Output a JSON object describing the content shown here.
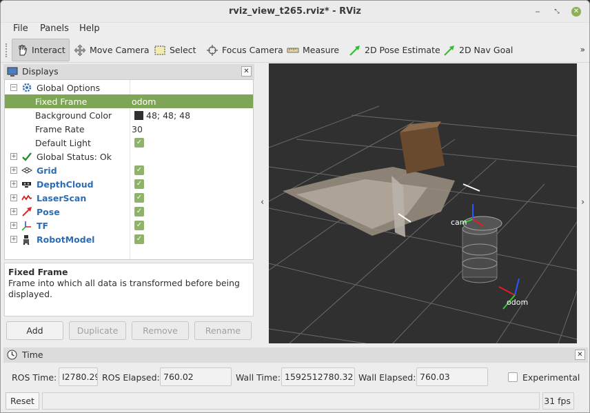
{
  "window": {
    "title": "rviz_view_t265.rviz* - RViz"
  },
  "menu": [
    "File",
    "Panels",
    "Help"
  ],
  "toolbar": {
    "tools": [
      {
        "label": "Interact",
        "icon": "hand-pointer-icon",
        "active": true
      },
      {
        "label": "Move Camera",
        "icon": "move-camera-icon"
      },
      {
        "label": "Select",
        "icon": "select-rect-icon"
      },
      {
        "label": "Focus Camera",
        "icon": "focus-crosshair-icon"
      },
      {
        "label": "Measure",
        "icon": "ruler-icon"
      },
      {
        "label": "2D Pose Estimate",
        "icon": "green-arrow-icon"
      },
      {
        "label": "2D Nav Goal",
        "icon": "green-arrow-icon"
      }
    ],
    "overflow": "»"
  },
  "displays": {
    "title": "Displays",
    "rows": [
      {
        "name": "Global Options",
        "type": "group",
        "expander": "−",
        "icon": "gear-icon"
      },
      {
        "name": "Fixed Frame",
        "value": "odom",
        "selected": true
      },
      {
        "name": "Background Color",
        "value": "48; 48; 48",
        "swatch": "#303030"
      },
      {
        "name": "Frame Rate",
        "value": "30"
      },
      {
        "name": "Default Light",
        "checked": true
      },
      {
        "name": "Global Status: Ok",
        "type": "status",
        "expander": "+",
        "icon": "check-icon"
      },
      {
        "name": "Grid",
        "type": "plugin",
        "expander": "+",
        "icon": "grid-icon",
        "checked": true
      },
      {
        "name": "DepthCloud",
        "type": "plugin",
        "expander": "+",
        "icon": "depthcloud-icon",
        "checked": true
      },
      {
        "name": "LaserScan",
        "type": "plugin",
        "expander": "+",
        "icon": "laserscan-icon",
        "checked": true
      },
      {
        "name": "Pose",
        "type": "plugin",
        "expander": "+",
        "icon": "pose-arrow-icon",
        "checked": true
      },
      {
        "name": "TF",
        "type": "plugin",
        "expander": "+",
        "icon": "tf-axes-icon",
        "checked": true
      },
      {
        "name": "RobotModel",
        "type": "plugin",
        "expander": "+",
        "icon": "robot-icon",
        "checked": true
      }
    ],
    "description": {
      "title": "Fixed Frame",
      "text": "Frame into which all data is transformed before being displayed."
    },
    "buttons": {
      "add": "Add",
      "duplicate": "Duplicate",
      "remove": "Remove",
      "rename": "Rename"
    }
  },
  "viewport": {
    "background": "#303030",
    "labels": {
      "camera": "cam",
      "odom": "odom"
    }
  },
  "time": {
    "title": "Time",
    "ros_time_label": "ROS Time:",
    "ros_time": "I2780.29",
    "ros_elapsed_label": "ROS Elapsed:",
    "ros_elapsed": "760.02",
    "wall_time_label": "Wall Time:",
    "wall_time": "1592512780.32",
    "wall_elapsed_label": "Wall Elapsed:",
    "wall_elapsed": "760.03",
    "experimental": "Experimental"
  },
  "status": {
    "reset": "Reset",
    "fps": "31 fps"
  }
}
